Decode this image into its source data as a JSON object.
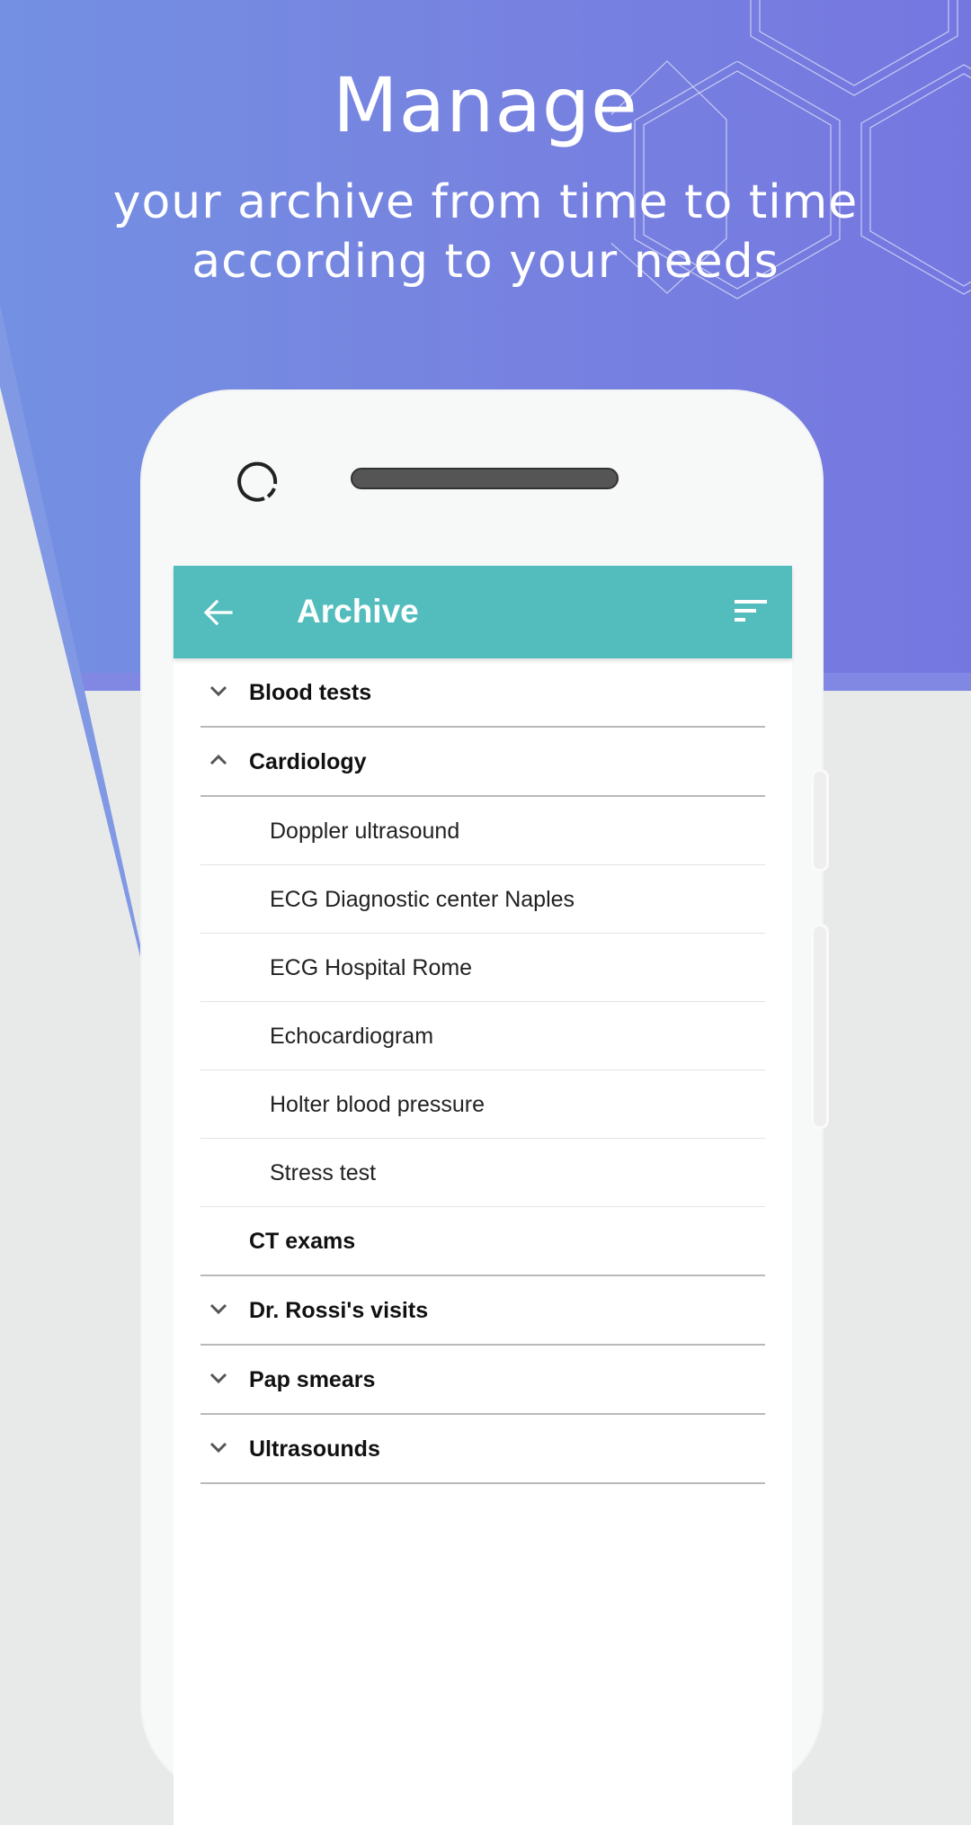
{
  "hero": {
    "title": "Manage",
    "subtitle_line1": "your archive from time to time",
    "subtitle_line2": "according to your needs"
  },
  "colors": {
    "hero_gradient_start": "#7390e2",
    "hero_gradient_end": "#7577e0",
    "appbar": "#53bdbd",
    "background": "#e8eaea"
  },
  "appbar": {
    "back_icon": "arrow-left-icon",
    "title": "Archive",
    "sort_icon": "sort-icon"
  },
  "archive": {
    "items": [
      {
        "label": "Blood tests",
        "type": "group",
        "state": "collapsed"
      },
      {
        "label": "Cardiology",
        "type": "group",
        "state": "expanded"
      },
      {
        "label": "Doppler ultrasound",
        "type": "child"
      },
      {
        "label": "ECG Diagnostic center Naples",
        "type": "child"
      },
      {
        "label": "ECG Hospital Rome",
        "type": "child"
      },
      {
        "label": "Echocardiogram",
        "type": "child"
      },
      {
        "label": "Holter blood pressure",
        "type": "child"
      },
      {
        "label": "Stress test",
        "type": "child"
      },
      {
        "label": "CT exams",
        "type": "group",
        "state": "none"
      },
      {
        "label": "Dr. Rossi's visits",
        "type": "group",
        "state": "collapsed"
      },
      {
        "label": "Pap smears",
        "type": "group",
        "state": "collapsed"
      },
      {
        "label": "Ultrasounds",
        "type": "group",
        "state": "collapsed"
      }
    ]
  }
}
